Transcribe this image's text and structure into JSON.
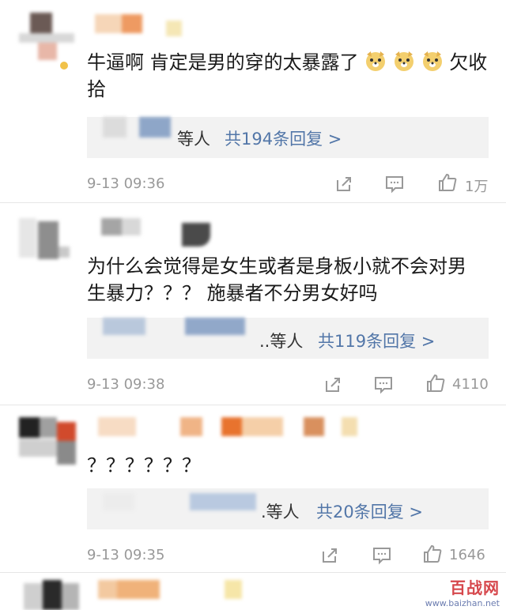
{
  "comments": [
    {
      "text": "牛逼啊 肯定是男的穿的太暴露了",
      "text_after": "欠收拾",
      "reply_who": "等人",
      "reply_count": "共194条回复 >",
      "time": "9-13 09:36",
      "likes": "1万"
    },
    {
      "text": "为什么会觉得是女生或者是身板小就不会对男生暴力？？？ 施暴者不分男女好吗",
      "reply_who": "..等人",
      "reply_count": "共119条回复 >",
      "time": "9-13 09:38",
      "likes": "4110"
    },
    {
      "text": "？？？？？？",
      "reply_who": ".等人",
      "reply_count": "共20条回复 >",
      "time": "9-13 09:35",
      "likes": "1646"
    }
  ],
  "emoji_name": "doge-emoji",
  "icons": {
    "share": "share-icon",
    "comment": "comment-icon",
    "like": "thumbs-up-icon"
  },
  "colors": {
    "reply_link": "#5276a8",
    "meta_gray": "#999999",
    "reply_bg": "#f2f2f2"
  },
  "watermark": {
    "brand": "百战网",
    "url": "www.baizhan.net"
  }
}
